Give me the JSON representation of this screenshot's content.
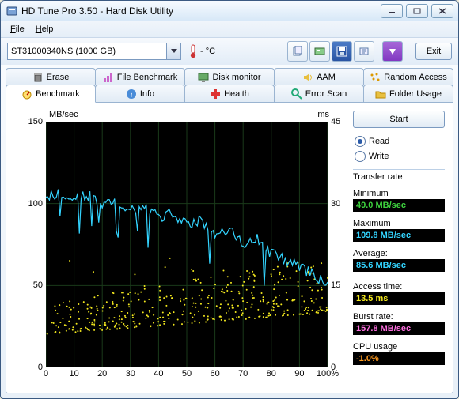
{
  "window": {
    "title": "HD Tune Pro 3.50 - Hard Disk Utility"
  },
  "menu": {
    "file": "File",
    "help": "Help"
  },
  "toolbar": {
    "drive": "ST31000340NS (1000 GB)",
    "temp": "- °C",
    "exit": "Exit"
  },
  "tabs_row1": {
    "erase": "Erase",
    "filebench": "File Benchmark",
    "diskmon": "Disk monitor",
    "aam": "AAM",
    "random": "Random Access"
  },
  "tabs_row2": {
    "benchmark": "Benchmark",
    "info": "Info",
    "health": "Health",
    "errorscan": "Error Scan",
    "folder": "Folder Usage"
  },
  "sidebar": {
    "start": "Start",
    "read": "Read",
    "write": "Write",
    "transfer_title": "Transfer rate",
    "min_lbl": "Minimum",
    "min_val": "49.0 MB/sec",
    "max_lbl": "Maximum",
    "max_val": "109.8 MB/sec",
    "avg_lbl": "Average:",
    "avg_val": "85.6 MB/sec",
    "access_lbl": "Access time:",
    "access_val": "13.5 ms",
    "burst_lbl": "Burst rate:",
    "burst_val": "157.8 MB/sec",
    "cpu_lbl": "CPU usage",
    "cpu_val": "-1.0%"
  },
  "chart_labels": {
    "y_left": "MB/sec",
    "y_right": "ms",
    "y_ticks": [
      "150",
      "100",
      "50",
      "0"
    ],
    "yr_ticks": [
      "45",
      "30",
      "15",
      "0"
    ],
    "x_ticks": [
      "0",
      "10",
      "20",
      "30",
      "40",
      "50",
      "60",
      "70",
      "80",
      "90",
      "100%"
    ]
  },
  "chart_data": {
    "type": "line+scatter",
    "title": "HD Tune Pro Benchmark",
    "x_range": [
      0,
      100
    ],
    "y_left_range": [
      0,
      150
    ],
    "y_right_range": [
      0,
      45
    ],
    "x_label_suffix": "%",
    "series": [
      {
        "name": "Transfer rate (MB/sec)",
        "axis": "left",
        "style": "line",
        "color": "#33d4ff",
        "x": [
          0,
          5,
          10,
          15,
          20,
          25,
          30,
          35,
          40,
          45,
          50,
          55,
          60,
          65,
          70,
          75,
          80,
          85,
          90,
          95,
          100
        ],
        "y": [
          105,
          106,
          103,
          105,
          100,
          102,
          96,
          98,
          92,
          94,
          88,
          90,
          82,
          84,
          76,
          78,
          70,
          65,
          62,
          56,
          52
        ]
      },
      {
        "name": "Access time (ms)",
        "axis": "right",
        "style": "scatter",
        "color": "#f4e91e",
        "note": "dense cloud ~400 pts, rising from ~8 ms to ~18 ms across 0-100%",
        "approx_band": {
          "x": [
            0,
            100
          ],
          "y_low": [
            6,
            10
          ],
          "y_high": [
            12,
            20
          ]
        }
      }
    ],
    "stats": {
      "min_mb": 49.0,
      "max_mb": 109.8,
      "avg_mb": 85.6,
      "access_ms": 13.5,
      "burst_mb": 157.8,
      "cpu_pct": -1.0
    }
  }
}
